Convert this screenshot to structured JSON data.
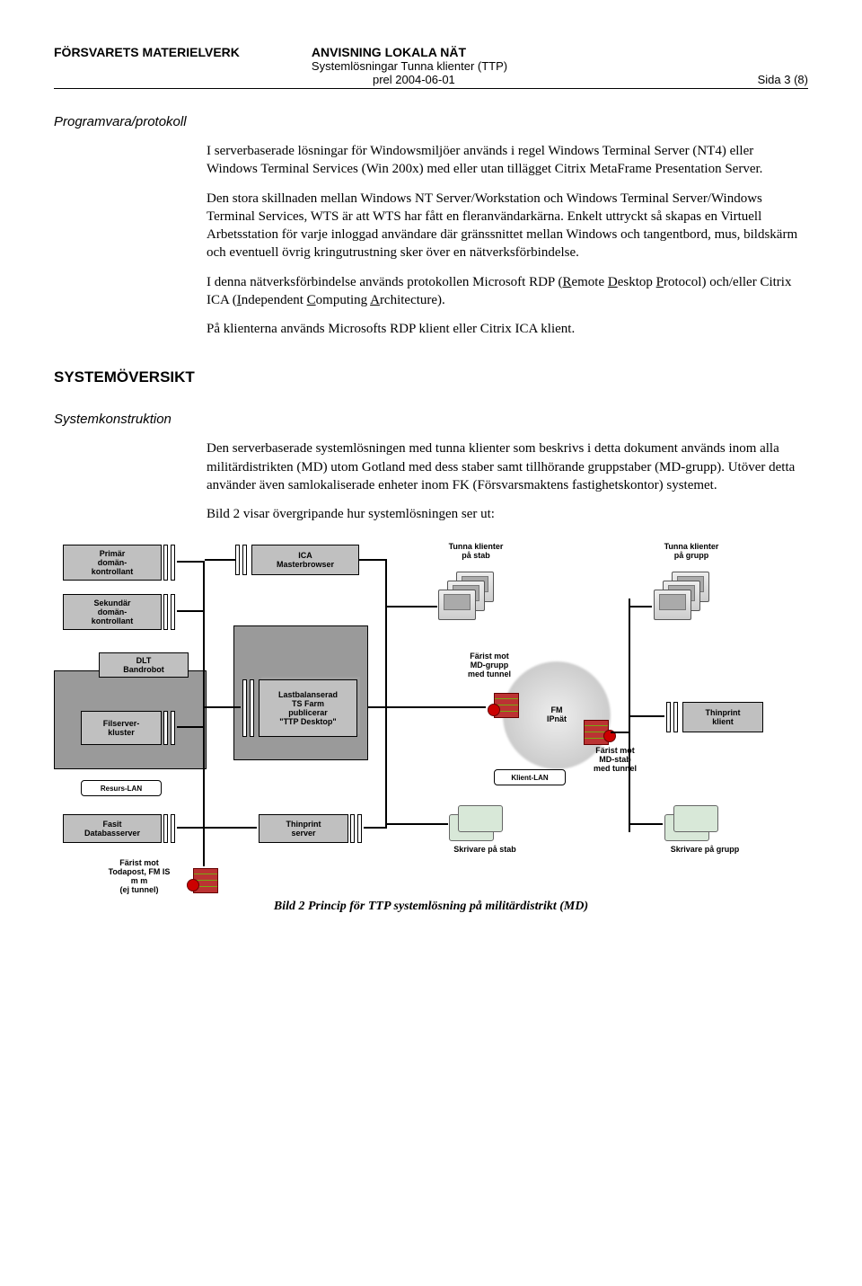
{
  "header": {
    "org": "FÖRSVARETS MATERIELVERK",
    "title": "ANVISNING LOKALA NÄT",
    "subtitle": "Systemlösningar Tunna klienter (TTP)",
    "date": "prel 2004-06-01",
    "page": "Sida 3 (8)"
  },
  "sec1_title": "Programvara/protokoll",
  "body": {
    "p1": "I serverbaserade lösningar för Windowsmiljöer används i regel Windows Terminal Server (NT4) eller Windows Terminal Services (Win 200x) med eller utan tillägget Citrix MetaFrame Presentation Server.",
    "p2": "Den stora skillnaden mellan Windows NT Server/Workstation och Windows Terminal Server/Windows Terminal Services, WTS är att WTS har fått en fleranvändarkärna. Enkelt uttryckt så skapas en Virtuell Arbetsstation för varje inloggad användare där gränssnittet mellan Windows och tangentbord, mus, bildskärm och eventuell övrig kringutrustning sker över en nätverksförbindelse.",
    "p3a": "I denna nätverksförbindelse används protokollen Microsoft RDP (",
    "p3_r": "R",
    "p3b": "emote ",
    "p3_d": "D",
    "p3c": "esktop ",
    "p3_p": "P",
    "p3d": "rotocol) och/eller Citrix ICA (",
    "p3_i": "I",
    "p3e": "ndependent ",
    "p3_c": "C",
    "p3f": "omputing ",
    "p3_a": "A",
    "p3g": "rchitecture).",
    "p4": "På klienterna används Microsofts RDP klient eller Citrix ICA klient."
  },
  "h1": "SYSTEMÖVERSIKT",
  "sec2_title": "Systemkonstruktion",
  "body2": {
    "p1": "Den serverbaserade systemlösningen med tunna klienter som beskrivs i detta dokument används  inom alla militärdistrikten (MD) utom Gotland med dess staber samt tillhörande gruppstaber (MD-grupp). Utöver detta använder även samlokaliserade enheter inom FK (Försvarsmaktens fastighetskontor) systemet.",
    "p2": "Bild 2 visar övergripande hur systemlösningen ser ut:"
  },
  "diagram": {
    "primar": "Primär\ndomän-\nkontrollant",
    "sekundar": "Sekundär\ndomän-\nkontrollant",
    "dlt": "DLT\nBandrobot",
    "filserver": "Filserver-\nkluster",
    "resurs": "Resurs-LAN",
    "fasit": "Fasit\nDatabasserver",
    "farist_toda": "Färist mot\nTodapost, FM IS\nm m\n(ej tunnel)",
    "ica": "ICA\nMasterbrowser",
    "tsfarm": "Lastbalanserad\nTS Farm\npublicerar\n\"TTP Desktop\"",
    "thinprint_srv": "Thinprint\nserver",
    "tunna_stab": "Tunna klienter\npå stab",
    "tunna_grupp": "Tunna klienter\npå grupp",
    "farist_grupp": "Färist mot\nMD-grupp\nmed tunnel",
    "fm_ipnat": "FM\nIPnät",
    "klient_lan": "Klient-LAN",
    "farist_stab": "Färist mot\nMD-stab\nmed tunnel",
    "thinprint_kli": "Thinprint\nklient",
    "skrivare_stab": "Skrivare på stab",
    "skrivare_grupp": "Skrivare på grupp"
  },
  "caption": "Bild 2 Princip för TTP systemlösning på militärdistrikt (MD)"
}
